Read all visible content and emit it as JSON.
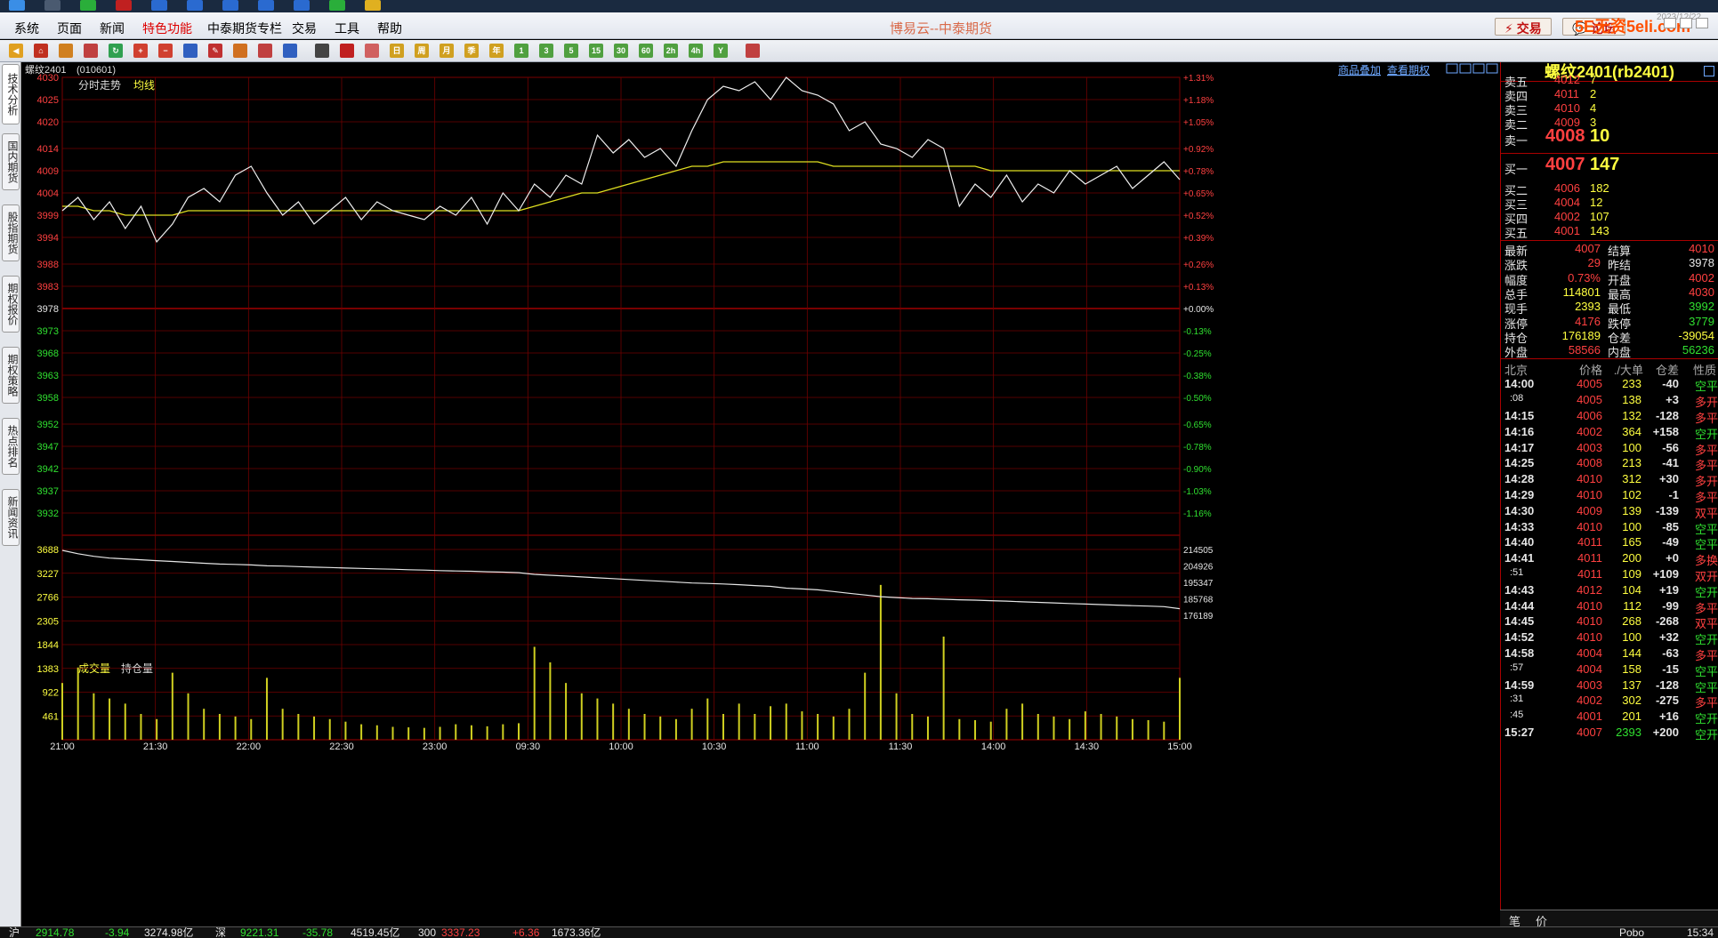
{
  "window": {
    "title": "博易云--中泰期货",
    "clock": "2023/12/22",
    "brand": "5E无资5eli.com"
  },
  "menu": [
    "系统",
    "页面",
    "新闻",
    "特色功能",
    "中泰期货专栏",
    "交易",
    "工具",
    "帮助"
  ],
  "menu_active_index": 3,
  "top_buttons": {
    "trade": "交易",
    "forum": "论坛"
  },
  "toolbar_labels": [
    "1",
    "3",
    "5",
    "15",
    "30",
    "60",
    "2h",
    "4h",
    "Y"
  ],
  "left_tabs": [
    "技术分析",
    "国内期货",
    "股指期货",
    "期权报价",
    "期权策略",
    "热点排名",
    "新闻资讯"
  ],
  "chart_header": {
    "symbol": "螺纹2401",
    "code": "(010601)",
    "links": [
      "商品叠加",
      "查看期权"
    ]
  },
  "price_panel": {
    "legend_time": "分时走势",
    "legend_avg": "均线"
  },
  "volume_panel": {
    "legend_volume": "成交量",
    "legend_oi": "持仓量"
  },
  "chart_data": {
    "type": "line",
    "x_ticks": [
      "21:00",
      "21:30",
      "22:00",
      "22:30",
      "23:00",
      "09:30",
      "10:00",
      "10:30",
      "11:00",
      "11:30",
      "14:00",
      "14:30",
      "15:00"
    ],
    "price_axis": {
      "ticks": [
        4030,
        4025,
        4020,
        4014,
        4009,
        4004,
        3999,
        3994,
        3988,
        3983,
        3978,
        3973,
        3968,
        3963,
        3958,
        3952,
        3947,
        3942,
        3937,
        3932
      ],
      "pct_ticks": [
        "+1.31%",
        "+1.18%",
        "+1.05%",
        "+0.92%",
        "+0.78%",
        "+0.65%",
        "+0.52%",
        "+0.39%",
        "+0.26%",
        "+0.13%",
        "+0.00%",
        "-0.13%",
        "-0.25%",
        "-0.38%",
        "-0.50%",
        "-0.65%",
        "-0.78%",
        "-0.90%",
        "-1.03%",
        "-1.16%"
      ],
      "prev_settle": 3978
    },
    "volume_axis": {
      "ticks": [
        3688,
        3227,
        2766,
        2305,
        1844,
        1383,
        922,
        461
      ],
      "oi_ticks": [
        214505,
        204926,
        195347,
        185768,
        176189
      ]
    },
    "price_series": [
      4000,
      4003,
      3998,
      4002,
      3996,
      4001,
      3993,
      3997,
      4003,
      4005,
      4002,
      4008,
      4010,
      4004,
      3999,
      4002,
      3997,
      4000,
      4003,
      3998,
      4002,
      4000,
      3999,
      3998,
      4001,
      3999,
      4003,
      3997,
      4004,
      4000,
      4006,
      4003,
      4008,
      4006,
      4017,
      4013,
      4016,
      4012,
      4014,
      4010,
      4018,
      4025,
      4028,
      4027,
      4029,
      4025,
      4030,
      4027,
      4026,
      4024,
      4018,
      4020,
      4015,
      4014,
      4012,
      4016,
      4014,
      4001,
      4006,
      4003,
      4008,
      4002,
      4006,
      4004,
      4009,
      4006,
      4008,
      4010,
      4005,
      4008,
      4011,
      4007
    ],
    "avg_series": [
      4001,
      4001,
      4000,
      4000,
      3999,
      3999,
      3999,
      3999,
      4000,
      4000,
      4000,
      4000,
      4000,
      4000,
      4000,
      4000,
      4000,
      4000,
      4000,
      4000,
      4000,
      4000,
      4000,
      4000,
      4000,
      4000,
      4000,
      4000,
      4000,
      4000,
      4001,
      4002,
      4003,
      4004,
      4004,
      4005,
      4006,
      4007,
      4008,
      4009,
      4010,
      4010,
      4011,
      4011,
      4011,
      4011,
      4011,
      4011,
      4011,
      4010,
      4010,
      4010,
      4010,
      4010,
      4010,
      4010,
      4010,
      4010,
      4010,
      4009,
      4009,
      4009,
      4009,
      4009,
      4009,
      4009,
      4009,
      4009,
      4009,
      4009,
      4009,
      4009
    ],
    "open_interest": [
      214000,
      212000,
      210500,
      209500,
      209000,
      208500,
      208000,
      207500,
      207000,
      206500,
      206000,
      205800,
      205500,
      205000,
      204800,
      204500,
      204200,
      204000,
      203700,
      203500,
      203200,
      203000,
      202700,
      202500,
      202200,
      202000,
      201800,
      201500,
      201300,
      201000,
      200000,
      199500,
      199000,
      198500,
      198000,
      197500,
      197000,
      196500,
      196000,
      195500,
      195000,
      194700,
      194400,
      194000,
      193500,
      193000,
      192000,
      191500,
      191000,
      190000,
      189000,
      188000,
      187000,
      186500,
      186000,
      185800,
      185500,
      185200,
      185000,
      184700,
      184400,
      184000,
      183700,
      183400,
      183000,
      182700,
      182400,
      182100,
      181800,
      181500,
      181200,
      180000
    ],
    "volume": [
      1100,
      1400,
      900,
      800,
      700,
      500,
      400,
      1300,
      900,
      600,
      500,
      450,
      400,
      1200,
      600,
      500,
      450,
      400,
      350,
      300,
      280,
      250,
      240,
      230,
      250,
      300,
      280,
      260,
      300,
      320,
      1800,
      1500,
      1100,
      900,
      800,
      700,
      600,
      500,
      450,
      400,
      600,
      800,
      500,
      700,
      500,
      650,
      700,
      550,
      500,
      450,
      600,
      1300,
      3000,
      900,
      500,
      450,
      2000,
      400,
      380,
      350,
      600,
      700,
      500,
      450,
      400,
      550,
      500,
      450,
      400,
      380,
      350,
      1200
    ]
  },
  "quote": {
    "title": "螺纹2401(rb2401)",
    "asks": [
      {
        "label": "卖五",
        "price": "4012",
        "vol": "7"
      },
      {
        "label": "卖四",
        "price": "4011",
        "vol": "2"
      },
      {
        "label": "卖三",
        "price": "4010",
        "vol": "4"
      },
      {
        "label": "卖二",
        "price": "4009",
        "vol": "3"
      },
      {
        "label": "卖一",
        "price": "4008",
        "vol": "10"
      }
    ],
    "bids": [
      {
        "label": "买一",
        "price": "4007",
        "vol": "147"
      },
      {
        "label": "买二",
        "price": "4006",
        "vol": "182"
      },
      {
        "label": "买三",
        "price": "4004",
        "vol": "12"
      },
      {
        "label": "买四",
        "price": "4002",
        "vol": "107"
      },
      {
        "label": "买五",
        "price": "4001",
        "vol": "143"
      }
    ],
    "stats": [
      {
        "l1": "最新",
        "v1": "4007",
        "l2": "结算",
        "v2": "4010"
      },
      {
        "l1": "涨跌",
        "v1": "29",
        "l2": "昨结",
        "v2": "3978"
      },
      {
        "l1": "幅度",
        "v1": "0.73%",
        "l2": "开盘",
        "v2": "4002"
      },
      {
        "l1": "总手",
        "v1": "114801",
        "l2": "最高",
        "v2": "4030"
      },
      {
        "l1": "现手",
        "v1": "2393",
        "l2": "最低",
        "v2": "3992"
      },
      {
        "l1": "涨停",
        "v1": "4176",
        "l2": "跌停",
        "v2": "3779"
      },
      {
        "l1": "持仓",
        "v1": "176189",
        "l2": "仓差",
        "v2": "-39054"
      },
      {
        "l1": "外盘",
        "v1": "58566",
        "l2": "内盘",
        "v2": "56236"
      }
    ],
    "tick_header": [
      "北京",
      "价格",
      "./大单",
      "仓差",
      "性质"
    ],
    "ticks": [
      [
        "14:00",
        "4005",
        "233",
        "-40",
        "空平"
      ],
      [
        ":08",
        "4005",
        "138",
        "+3",
        "多开"
      ],
      [
        "14:15",
        "4006",
        "132",
        "-128",
        "多平"
      ],
      [
        "14:16",
        "4002",
        "364",
        "+158",
        "空开"
      ],
      [
        "14:17",
        "4003",
        "100",
        "-56",
        "多平"
      ],
      [
        "14:25",
        "4008",
        "213",
        "-41",
        "多平"
      ],
      [
        "14:28",
        "4010",
        "312",
        "+30",
        "多开"
      ],
      [
        "14:29",
        "4010",
        "102",
        "-1",
        "多平"
      ],
      [
        "14:30",
        "4009",
        "139",
        "-139",
        "双平"
      ],
      [
        "14:33",
        "4010",
        "100",
        "-85",
        "空平"
      ],
      [
        "14:40",
        "4011",
        "165",
        "-49",
        "空平"
      ],
      [
        "14:41",
        "4011",
        "200",
        "+0",
        "多换"
      ],
      [
        ":51",
        "4011",
        "109",
        "+109",
        "双开"
      ],
      [
        "14:43",
        "4012",
        "104",
        "+19",
        "空开"
      ],
      [
        "14:44",
        "4010",
        "112",
        "-99",
        "多平"
      ],
      [
        "14:45",
        "4010",
        "268",
        "-268",
        "双平"
      ],
      [
        "14:52",
        "4010",
        "100",
        "+32",
        "空开"
      ],
      [
        "14:58",
        "4004",
        "144",
        "-63",
        "多平"
      ],
      [
        ":57",
        "4004",
        "158",
        "-15",
        "空平"
      ],
      [
        "14:59",
        "4003",
        "137",
        "-128",
        "空平"
      ],
      [
        ":31",
        "4002",
        "302",
        "-275",
        "多平"
      ],
      [
        ":45",
        "4001",
        "201",
        "+16",
        "空开"
      ],
      [
        "15:27",
        "4007",
        "2393",
        "+200",
        "空开"
      ]
    ],
    "bottom_tabs": [
      "笔",
      "价"
    ]
  },
  "statusbar": {
    "sh_label": "沪",
    "sh_value": "2914.78",
    "sh_change": "-3.94",
    "sh_amount": "3274.98亿",
    "sz_label": "深",
    "sz_value": "9221.31",
    "sz_change": "-35.78",
    "sz_amount": "4519.45亿",
    "c300_label": "300",
    "c300_value": "3337.23",
    "c300_change": "+6.36",
    "c300_amount": "1673.36亿",
    "right": "Pobo",
    "time": "15:34"
  }
}
